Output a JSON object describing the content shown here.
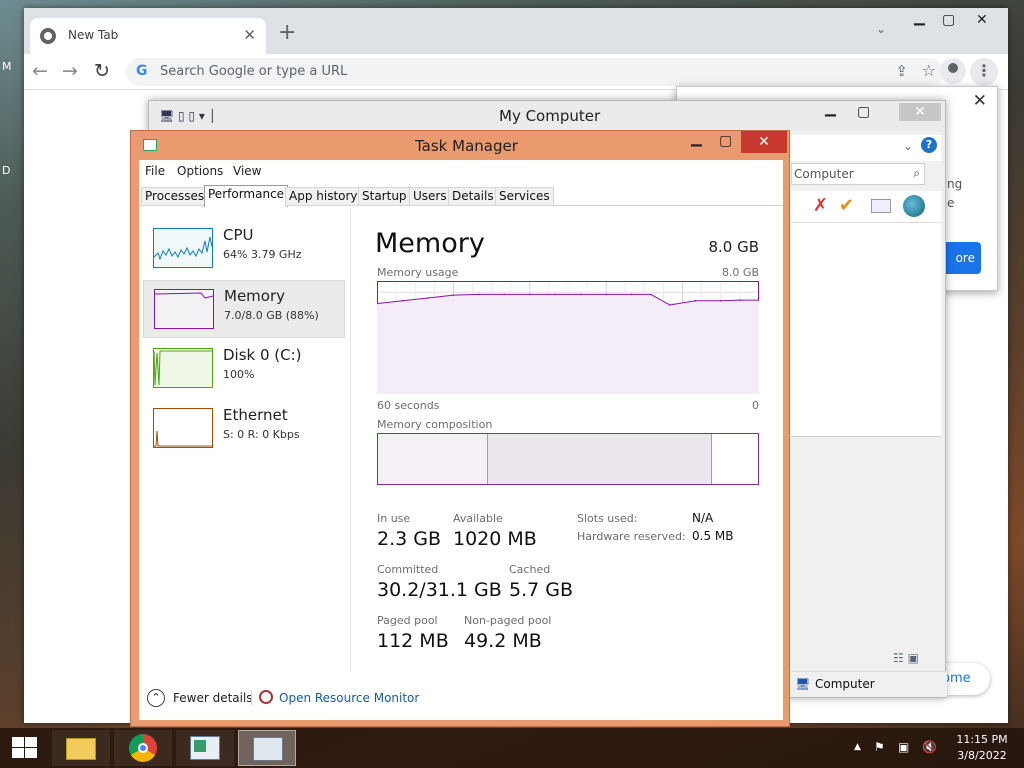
{
  "desktop": {
    "edge_letters": [
      "M",
      "D"
    ]
  },
  "chrome": {
    "tab_title": "New Tab",
    "omnibox_placeholder": "Search Google or type a URL",
    "popup_text_fragments": [
      "ng",
      "e"
    ],
    "popup_button_fragment": "ore",
    "get_chrome_fragment": "ome"
  },
  "mycomputer": {
    "title": "My Computer",
    "search_text": "Computer",
    "status_item": "Computer"
  },
  "taskmanager": {
    "title": "Task Manager",
    "menu": [
      "File",
      "Options",
      "View"
    ],
    "tabs": [
      "Processes",
      "Performance",
      "App history",
      "Startup",
      "Users",
      "Details",
      "Services"
    ],
    "active_tab": "Performance",
    "sidebar": [
      {
        "name": "CPU",
        "value": "64%  3.79 GHz",
        "color": "#117dbb"
      },
      {
        "name": "Memory",
        "value": "7.0/8.0 GB (88%)",
        "color": "#8b12ae"
      },
      {
        "name": "Disk 0 (C:)",
        "value": "100%",
        "color": "#4da60c"
      },
      {
        "name": "Ethernet",
        "value": "S: 0  R: 0 Kbps",
        "color": "#a74f01"
      }
    ],
    "memory": {
      "heading": "Memory",
      "total": "8.0 GB",
      "usage_label": "Memory usage",
      "usage_max": "8.0 GB",
      "time_left": "60 seconds",
      "time_right": "0",
      "composition_label": "Memory composition",
      "composition": {
        "in_use_fraction": 0.29,
        "modified_fraction": 0.59
      },
      "stats": {
        "in_use_label": "In use",
        "in_use": "2.3 GB",
        "available_label": "Available",
        "available": "1020 MB",
        "committed_label": "Committed",
        "committed": "30.2/31.1 GB",
        "cached_label": "Cached",
        "cached": "5.7 GB",
        "paged_label": "Paged pool",
        "paged": "112 MB",
        "nonpaged_label": "Non-paged pool",
        "nonpaged": "49.2 MB",
        "slots_label": "Slots used:",
        "slots": "N/A",
        "hwres_label": "Hardware reserved:",
        "hwres": "0.5 MB"
      }
    },
    "footer": {
      "fewer_details": "Fewer details",
      "resource_monitor": "Open Resource Monitor"
    }
  },
  "chart_data": {
    "type": "area",
    "ylabel": "Memory usage",
    "ylim": [
      0,
      8.0
    ],
    "x": [
      60,
      56,
      52,
      48,
      44,
      40,
      36,
      32,
      28,
      24,
      20,
      17,
      14,
      10,
      6,
      3,
      0
    ],
    "values": [
      6.4,
      6.6,
      6.8,
      7.0,
      7.05,
      7.05,
      7.05,
      7.05,
      7.05,
      7.05,
      7.05,
      7.05,
      6.3,
      6.6,
      6.6,
      6.65,
      6.65
    ]
  },
  "taskbar": {
    "time": "11:15 PM",
    "date": "3/8/2022",
    "apps": [
      "file-explorer",
      "chrome",
      "my-computer",
      "task-manager"
    ],
    "active_app": "task-manager"
  },
  "colors": {
    "memory_accent": "#8b12ae",
    "tm_frame": "#e99a6f",
    "close_red": "#c7392d",
    "chrome_blue": "#1a73e8"
  }
}
